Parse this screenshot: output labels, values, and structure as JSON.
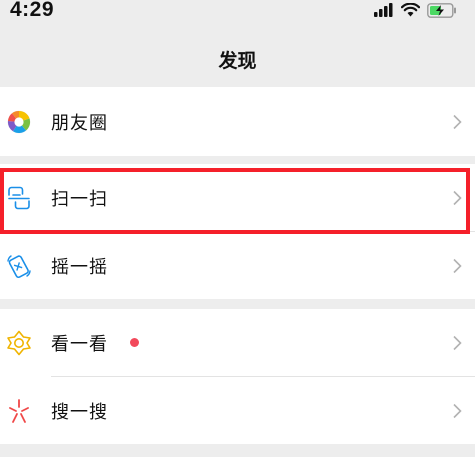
{
  "status_bar": {
    "time": "4:29"
  },
  "header": {
    "title": "发现"
  },
  "menu": {
    "moments": {
      "label": "朋友圈"
    },
    "scan": {
      "label": "扫一扫"
    },
    "shake": {
      "label": "摇一摇"
    },
    "top_stories": {
      "label": "看一看"
    },
    "search": {
      "label": "搜一搜"
    }
  },
  "colors": {
    "background": "#ededed",
    "highlight_border": "#f5202a",
    "badge_dot": "#f2495b",
    "scan_icon": "#1a8fe8",
    "shake_icon": "#1a8fe8",
    "top_stories_icon": "#f0b400",
    "search_icon": "#f04848"
  },
  "icons": {
    "moments": "moments-camera-aperture-icon",
    "scan": "scan-icon",
    "shake": "shake-phone-icon",
    "top_stories": "top-stories-icon",
    "search": "search-sparkle-icon",
    "chevron": "chevron-right-icon"
  }
}
